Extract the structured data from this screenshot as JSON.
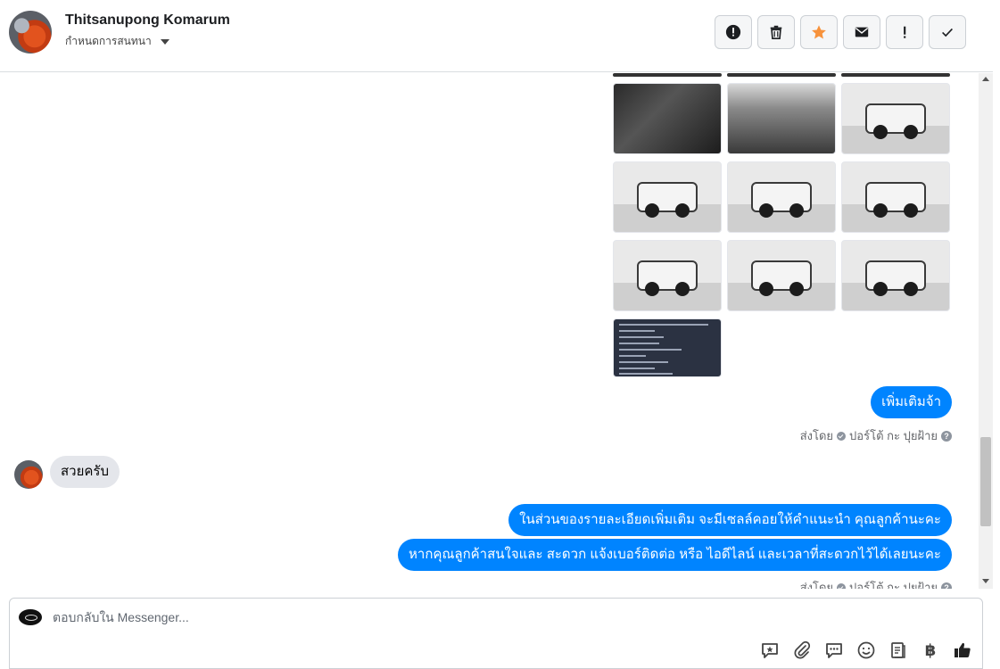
{
  "header": {
    "contact_name": "Thitsanupong Komarum",
    "label_text": "กำหนดการสนทนา",
    "actions": [
      {
        "name": "mark-spam-button",
        "icon": "alert-circle-icon"
      },
      {
        "name": "delete-button",
        "icon": "trash-icon"
      },
      {
        "name": "star-button",
        "icon": "star-icon"
      },
      {
        "name": "mark-unread-button",
        "icon": "envelope-icon"
      },
      {
        "name": "follow-up-button",
        "icon": "exclamation-icon"
      },
      {
        "name": "mark-done-button",
        "icon": "check-icon"
      }
    ],
    "star_color": "#f7923b"
  },
  "thread": {
    "photo_grid_rows": 3,
    "photo_grid_cols": 3,
    "messages": [
      {
        "dir": "out",
        "text": "เพิ่มเติมจ้า"
      },
      {
        "dir": "meta",
        "sent_prefix": "ส่งโดย",
        "sender": "ปอร์โต้ กะ ปุยฝ้าย"
      },
      {
        "dir": "in",
        "text": "สวยครับ"
      },
      {
        "dir": "out",
        "text": "ในส่วนของรายละเอียดเพิ่มเติม จะมีเซลล์คอยให้คำแนะนำ คุณลูกค้านะคะ"
      },
      {
        "dir": "out",
        "text": "หากคุณลูกค้าสนใจและ สะดวก แจ้งเบอร์ติดต่อ หรือ ไอดีไลน์ และเวลาที่สะดวกไว้ได้เลยนะคะ"
      },
      {
        "dir": "meta",
        "sent_prefix": "ส่งโดย",
        "sender": "ปอร์โต้ กะ ปุยฝ้าย"
      }
    ],
    "bubble_out_color": "#0084ff",
    "bubble_in_color": "#e4e6eb"
  },
  "composer": {
    "placeholder": "ตอบกลับใน Messenger...",
    "tools": [
      "saved-reply-icon",
      "attachment-icon",
      "chat-bubbles-icon",
      "emoji-icon",
      "notes-icon",
      "baht-icon",
      "thumbs-up-icon"
    ],
    "baht_symbol": "฿"
  }
}
